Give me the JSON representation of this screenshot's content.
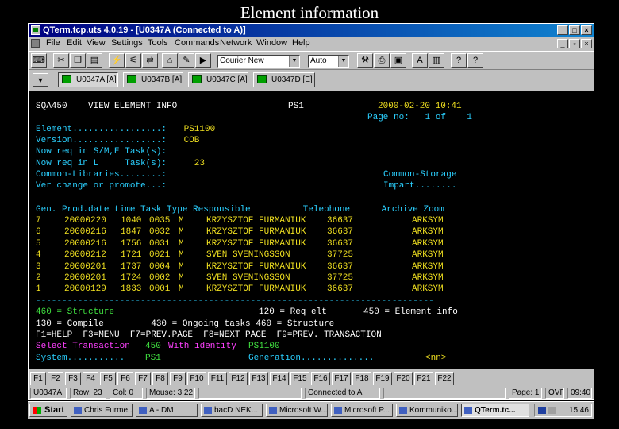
{
  "slide_title": "Element information",
  "window": {
    "title": "QTerm.tcp.uts 4.0.19 - [U0347A (Connected to A)]",
    "controls": [
      "_",
      "□",
      "×"
    ],
    "mdi_controls": [
      "_",
      "▫",
      "×"
    ]
  },
  "menu": [
    "File",
    "Edit",
    "View",
    "Settings",
    "Tools",
    "Commands",
    "Network",
    "Window",
    "Help"
  ],
  "toolbar": {
    "font_combo": "Courier New",
    "size_combo": "Auto"
  },
  "sessions": [
    {
      "label": "U0347A [A]",
      "active": true
    },
    {
      "label": "U0347B [A]",
      "active": false
    },
    {
      "label": "U0347C [A]",
      "active": false
    },
    {
      "label": "U0347D [E]",
      "active": false
    }
  ],
  "terminal": {
    "header_left": "SQA450    VIEW ELEMENT INFO",
    "header_mid": "PS1",
    "header_right": "2000-02-20 10:41",
    "page_line": "Page no:   1 of    1",
    "info": [
      {
        "label": "Element.................:",
        "value": " PS1100"
      },
      {
        "label": "Version.................:",
        "value": " COB"
      },
      {
        "label": "Now req in S/M,E Task(s):",
        "value": ""
      },
      {
        "label": "Now req in L     Task(s):",
        "value": "   23"
      },
      {
        "label": "Common-Libraries........:",
        "value": ""
      },
      {
        "label": "Ver change or promote...:",
        "value": ""
      }
    ],
    "common_storage": "Common-Storage",
    "impart": "Impart........",
    "table_header": "Gen. Prod.date time Task Type Responsible          Telephone      Archive Zoom",
    "rows": [
      {
        "gen": "7",
        "date": "20000220",
        "time": "1040",
        "task": "0035",
        "type": "M",
        "resp": "KRZYSZTOF FURMANIUK",
        "tel": "36637",
        "archive": "ARKSYM"
      },
      {
        "gen": "6",
        "date": "20000216",
        "time": "1847",
        "task": "0032",
        "type": "M",
        "resp": "KRZYSZTOF FURMANIUK",
        "tel": "36637",
        "archive": "ARKSYM"
      },
      {
        "gen": "5",
        "date": "20000216",
        "time": "1756",
        "task": "0031",
        "type": "M",
        "resp": "KRZYSZTOF FURMANIUK",
        "tel": "36637",
        "archive": "ARKSYM"
      },
      {
        "gen": "4",
        "date": "20000212",
        "time": "1721",
        "task": "0021",
        "type": "M",
        "resp": "SVEN SVENINGSSON",
        "tel": "37725",
        "archive": "ARKSYM"
      },
      {
        "gen": "3",
        "date": "20000201",
        "time": "1737",
        "task": "0004",
        "type": "M",
        "resp": "KRZYSZTOF FURMANIUK",
        "tel": "36637",
        "archive": "ARKSYM"
      },
      {
        "gen": "2",
        "date": "20000201",
        "time": "1724",
        "task": "0002",
        "type": "M",
        "resp": "SVEN SVENINGSSON",
        "tel": "37725",
        "archive": "ARKSYM"
      },
      {
        "gen": "1",
        "date": "20000129",
        "time": "1833",
        "task": "0001",
        "type": "M",
        "resp": "KRZYSZTOF FURMANIUK",
        "tel": "36637",
        "archive": "ARKSYM"
      }
    ],
    "separator": "----------------------------------------------------------------------------",
    "opt1_left": "460 = Structure",
    "opt1_right": "120 = Req elt       450 = Element info",
    "opt2": "130 = Compile         430 = Ongoing tasks 460 = Structure",
    "keys": "F1=HELP  F3=MENU  F7=PREV.PAGE  F8=NEXT PAGE  F9=PREV. TRANSACTION",
    "select_a": "Select Transaction",
    "select_b": "450",
    "select_c": "With identity",
    "select_d": "PS1100",
    "system_label": "System...........",
    "system_value": "PS1",
    "generation_label": "Generation..............",
    "generation_value": "<nn>"
  },
  "fkeys": [
    "F1",
    "F2",
    "F3",
    "F4",
    "F5",
    "F6",
    "F7",
    "F8",
    "F9",
    "F10",
    "F11",
    "F12",
    "F13",
    "F14",
    "F15",
    "F16",
    "F17",
    "F18",
    "F19",
    "F20",
    "F21",
    "F22"
  ],
  "status": {
    "session": "U0347A",
    "row": "Row: 23",
    "col": "Col: 0",
    "mouse": "Mouse: 3:22",
    "connection": "Connected to A",
    "page": "Page: 1",
    "ovr": "OVR",
    "clock": "09:40"
  },
  "taskbar": {
    "start": "Start",
    "tasks": [
      {
        "label": "Chris Furme...",
        "active": false
      },
      {
        "label": "A - DM",
        "active": false
      },
      {
        "label": "bacD NEK...",
        "active": false
      },
      {
        "label": "Microsoft W...",
        "active": false
      },
      {
        "label": "Microsoft P...",
        "active": false
      },
      {
        "label": "Kommuniko...",
        "active": false
      },
      {
        "label": "QTerm.tc...",
        "active": true
      }
    ],
    "time": "15:46"
  }
}
